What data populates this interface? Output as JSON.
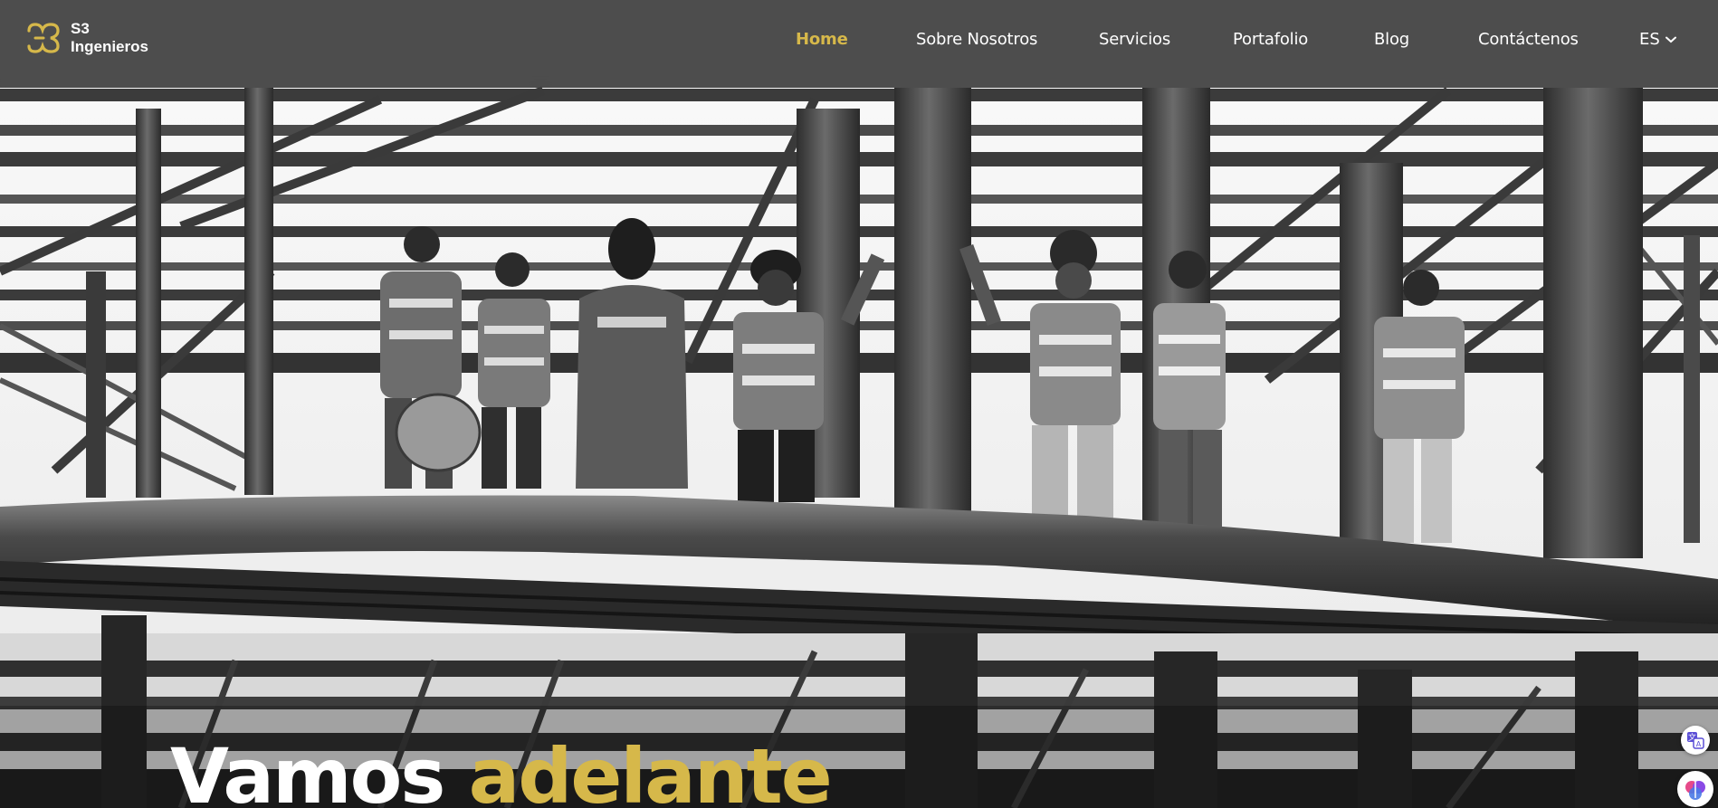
{
  "brand": {
    "name_line1": "S3",
    "name_line2": "Ingenieros",
    "accent_color": "#d6b84a"
  },
  "nav": {
    "items": [
      {
        "label": "Home",
        "active": true
      },
      {
        "label": "Sobre Nosotros",
        "active": false
      },
      {
        "label": "Servicios",
        "active": false
      },
      {
        "label": "Portafolio",
        "active": false
      },
      {
        "label": "Blog",
        "active": false
      },
      {
        "label": "Contáctenos",
        "active": false
      }
    ],
    "language": "ES",
    "language_icon": "chevron-down-icon"
  },
  "hero": {
    "image": "grayscale photo of construction workers in safety vests on a steel structure",
    "headline_white": "Vamos",
    "headline_accent": "adelante"
  },
  "widgets": {
    "translate_icon": "translate-icon",
    "assistant_icon": "brain-icon"
  }
}
